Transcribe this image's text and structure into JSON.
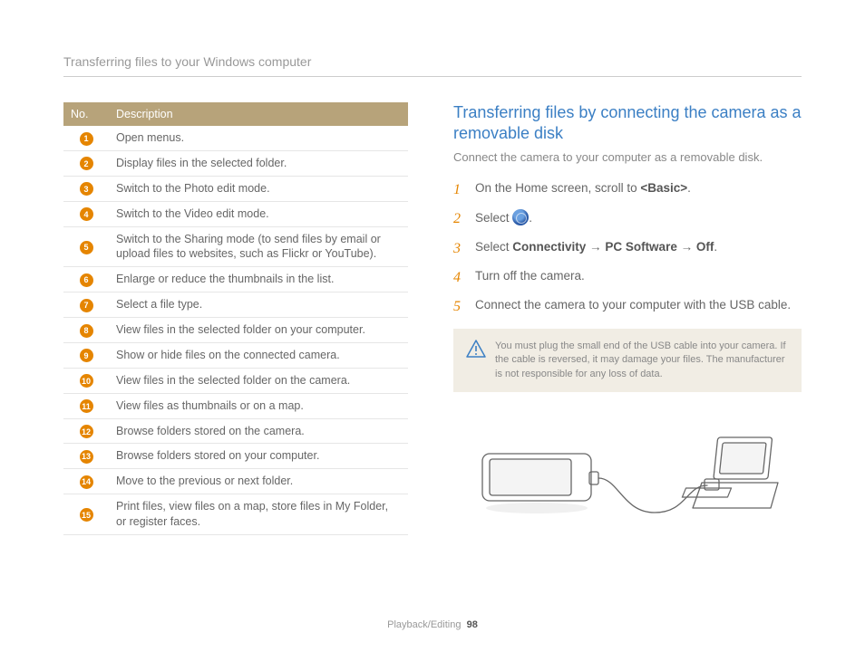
{
  "header": "Transferring files to your Windows computer",
  "table": {
    "headers": [
      "No.",
      "Description"
    ],
    "rows": [
      {
        "n": "1",
        "desc": "Open menus."
      },
      {
        "n": "2",
        "desc": "Display files in the selected folder."
      },
      {
        "n": "3",
        "desc": "Switch to the Photo edit mode."
      },
      {
        "n": "4",
        "desc": "Switch to the Video edit mode."
      },
      {
        "n": "5",
        "desc": "Switch to the Sharing mode (to send files by email or upload files to websites, such as Flickr or YouTube)."
      },
      {
        "n": "6",
        "desc": "Enlarge or reduce the thumbnails in the list."
      },
      {
        "n": "7",
        "desc": "Select a file type."
      },
      {
        "n": "8",
        "desc": "View files in the selected folder on your computer."
      },
      {
        "n": "9",
        "desc": "Show or hide files on the connected camera."
      },
      {
        "n": "10",
        "desc": "View files in the selected folder on the camera."
      },
      {
        "n": "11",
        "desc": "View files as thumbnails or on a map."
      },
      {
        "n": "12",
        "desc": "Browse folders stored on the camera."
      },
      {
        "n": "13",
        "desc": "Browse folders stored on your computer."
      },
      {
        "n": "14",
        "desc": "Move to the previous or next folder."
      },
      {
        "n": "15",
        "desc": "Print files, view files on a map, store files in My Folder, or register faces."
      }
    ]
  },
  "section": {
    "title": "Transferring files by connecting the camera as a removable disk",
    "intro": "Connect the camera to your computer as a removable disk.",
    "steps": {
      "s1_pre": "On the Home screen, scroll to ",
      "s1_bold": "<Basic>",
      "s1_post": ".",
      "s2_pre": "Select ",
      "s2_post": ".",
      "s3_pre": "Select ",
      "s3_b1": "Connectivity",
      "s3_arrow": " → ",
      "s3_b2": "PC Software",
      "s3_b3": "Off",
      "s3_post": ".",
      "s4": "Turn off the camera.",
      "s5": "Connect the camera to your computer with the USB cable."
    },
    "warning": "You must plug the small end of the USB cable into your camera. If the cable is reversed, it may damage your files. The manufacturer is not responsible for any loss of data."
  },
  "footer": {
    "section": "Playback/Editing",
    "page": "98"
  }
}
